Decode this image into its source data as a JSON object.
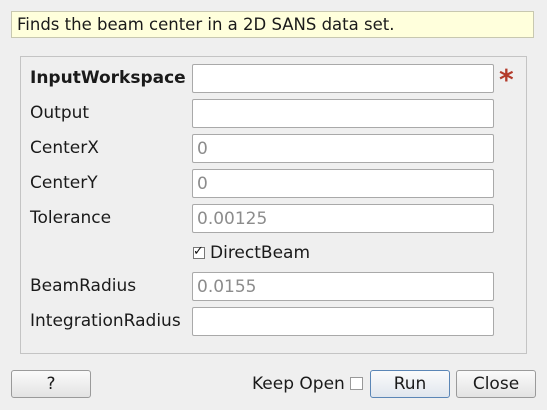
{
  "description": "Finds the beam center in a 2D SANS data set.",
  "fields": {
    "input_workspace": {
      "label": "InputWorkspace",
      "value": "",
      "placeholder": ""
    },
    "output": {
      "label": "Output",
      "value": "",
      "placeholder": ""
    },
    "center_x": {
      "label": "CenterX",
      "value": "",
      "placeholder": "0"
    },
    "center_y": {
      "label": "CenterY",
      "value": "",
      "placeholder": "0"
    },
    "tolerance": {
      "label": "Tolerance",
      "value": "",
      "placeholder": "0.00125"
    },
    "beam_radius": {
      "label": "BeamRadius",
      "value": "",
      "placeholder": "0.0155"
    },
    "integration_radius": {
      "label": "IntegrationRadius",
      "value": "",
      "placeholder": ""
    }
  },
  "required_marker": "*",
  "direct_beam": {
    "label": "DirectBeam",
    "checked": true,
    "mark": "✓"
  },
  "footer": {
    "help_label": "?",
    "keep_open_label": "Keep Open",
    "keep_open_checked": false,
    "run_label": "Run",
    "close_label": "Close"
  },
  "colors": {
    "tooltip_bg": "#ffffdc",
    "required_marker": "#b33a2a",
    "window_bg": "#efefef"
  }
}
